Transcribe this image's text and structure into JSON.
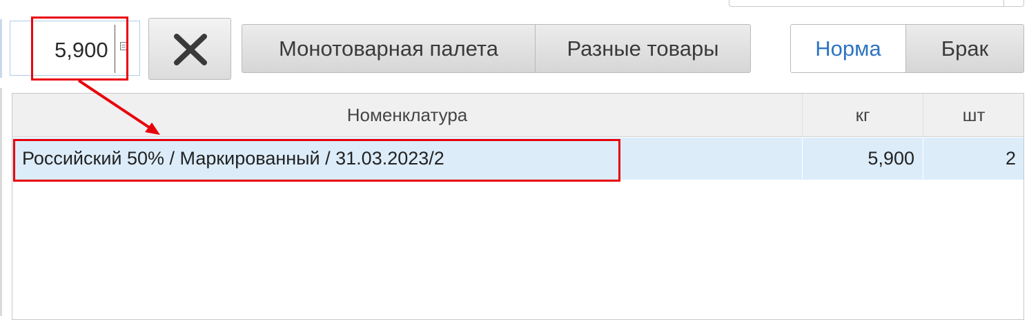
{
  "weight_input": {
    "value": "5,900",
    "icon": "calculator-icon"
  },
  "clear_button": {
    "icon": "close-icon"
  },
  "pallet_type": {
    "options": [
      "Монотоварная палета",
      "Разные товары"
    ]
  },
  "quality": {
    "options": [
      "Норма",
      "Брак"
    ],
    "selected": "Норма"
  },
  "table": {
    "columns": [
      "Номенклатура",
      "кг",
      "шт"
    ],
    "rows": [
      {
        "name": "Российский 50% / Маркированный / 31.03.2023/2",
        "kg": "5,900",
        "pcs": "2"
      }
    ]
  },
  "colors": {
    "annotation": "#e8000b",
    "selected_row": "#dcecf9",
    "accent": "#2e74c0"
  }
}
